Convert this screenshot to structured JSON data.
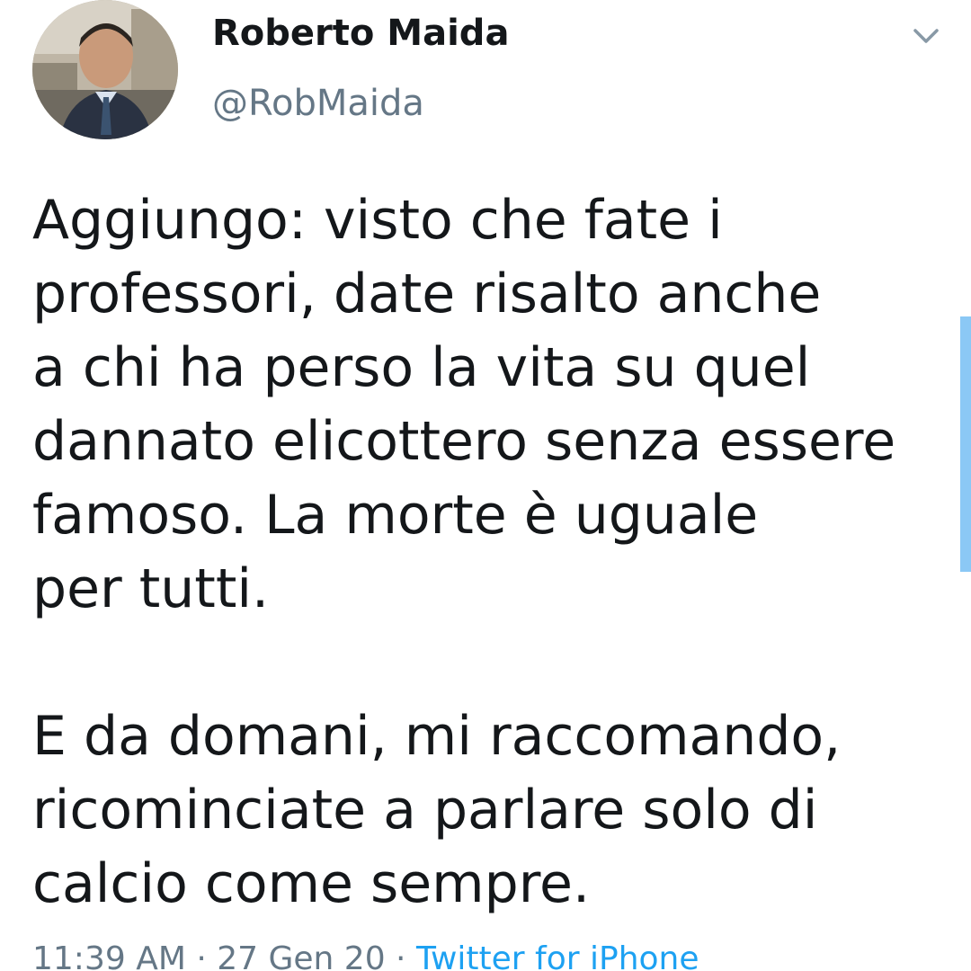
{
  "author": {
    "display_name": "Roberto Maida",
    "handle": "@RobMaida",
    "avatar_icon": "profile-photo"
  },
  "menu": {
    "icon": "chevron-down-icon"
  },
  "tweet": {
    "paragraph1": [
      "Aggiungo: visto che fate i",
      "professori, date risalto anche",
      "a chi ha perso la vita su quel",
      "dannato elicottero senza essere",
      "famoso. La morte è uguale",
      "per tutti."
    ],
    "paragraph2": [
      "E da domani, mi raccomando,",
      "ricominciate a parlare solo di",
      "calcio come sempre."
    ]
  },
  "meta": {
    "time": "11:39 AM",
    "separator1": " · ",
    "date": "27 Gen 20",
    "separator2": " · ",
    "source": "Twitter for iPhone"
  },
  "colors": {
    "text": "#14171a",
    "secondary": "#657786",
    "accent": "#1da1f2"
  }
}
